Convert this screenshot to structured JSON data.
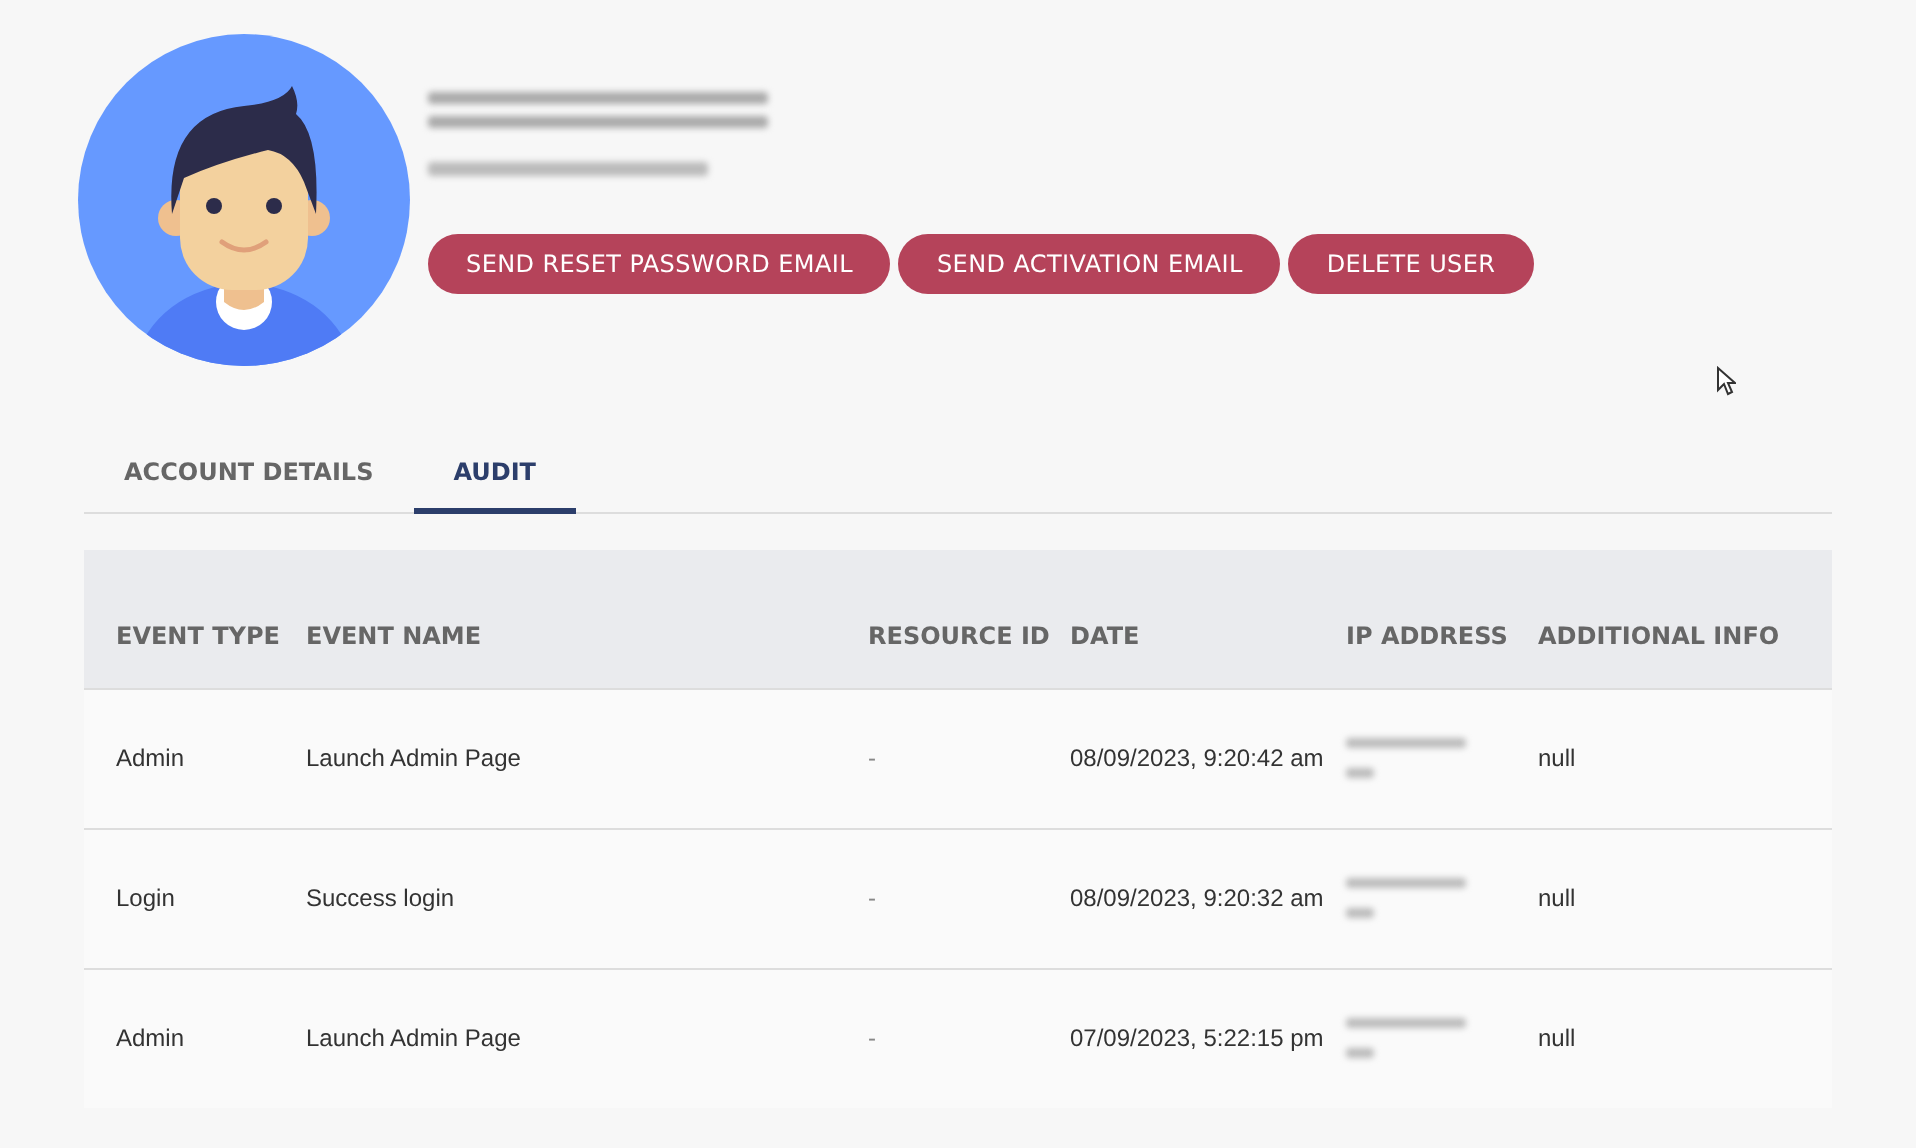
{
  "profile": {
    "actions": [
      {
        "label": "SEND RESET PASSWORD EMAIL"
      },
      {
        "label": "SEND ACTIVATION EMAIL"
      },
      {
        "label": "DELETE USER"
      }
    ]
  },
  "tabs": [
    {
      "label": "ACCOUNT DETAILS",
      "selected": false
    },
    {
      "label": "AUDIT",
      "selected": true
    }
  ],
  "table": {
    "columns": [
      "EVENT TYPE",
      "EVENT NAME",
      "RESOURCE ID",
      "DATE",
      "IP ADDRESS",
      "ADDITIONAL INFO"
    ],
    "rows": [
      {
        "event_type": "Admin",
        "event_name": "Launch Admin Page",
        "resource_id": "-",
        "date": "08/09/2023, 9:20:42 am",
        "additional_info": "null"
      },
      {
        "event_type": "Login",
        "event_name": "Success login",
        "resource_id": "-",
        "date": "08/09/2023, 9:20:32 am",
        "additional_info": "null"
      },
      {
        "event_type": "Admin",
        "event_name": "Launch Admin Page",
        "resource_id": "-",
        "date": "07/09/2023, 5:22:15 pm",
        "additional_info": "null"
      }
    ]
  }
}
